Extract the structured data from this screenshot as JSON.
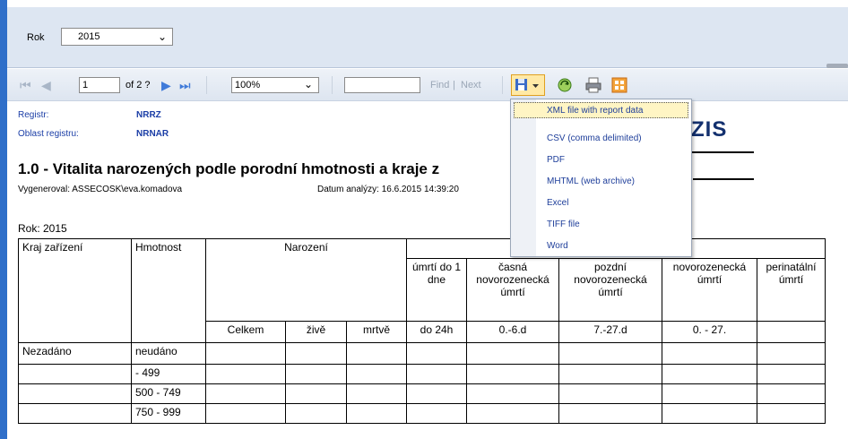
{
  "params": {
    "year_label": "Rok",
    "year_value": "2015"
  },
  "toolbar": {
    "first_icon": "⏮",
    "prev_icon": "◀",
    "page_value": "1",
    "page_of": "of 2 ?",
    "next_icon": "▶",
    "last_icon": "⏭",
    "zoom_value": "100%",
    "find_value": "",
    "find_label": "Find",
    "separator": "|",
    "next_label": "Next"
  },
  "export_menu": {
    "items": [
      "XML file with report data",
      "CSV (comma delimited)",
      "PDF",
      "MHTML (web archive)",
      "Excel",
      "TIFF file",
      "Word"
    ],
    "selected_index": 0
  },
  "report": {
    "registry_label": "Registr:",
    "registry_value": "NRRZ",
    "area_label": "Oblast registru:",
    "area_value": "NRNAR",
    "brand": "ZIS",
    "title": "1.0 - Vitalita narozených podle porodní hmotnosti a kraje z",
    "generated": "Vygeneroval: ASSECOSK\\eva.komadova",
    "analysis_date": "Datum analýzy: 16.6.2015 14:39:20",
    "year_line": "Rok: 2015",
    "table": {
      "col_region": "Kraj zařízení",
      "col_weight": "Hmotnost",
      "col_births": "Narození",
      "death_headers": [
        "úmrtí do 1 dne",
        "časná novorozenecká úmrtí",
        "pozdní novorozenecká úmrtí",
        "novorozenecká úmrtí",
        "perinatální úmrtí"
      ],
      "sub_headers": [
        "Celkem",
        "živě",
        "mrtvě",
        "do 24h",
        "0.-6.d",
        "7.-27.d",
        "0. - 27.",
        ""
      ],
      "rows": [
        {
          "region": "Nezadáno",
          "weight": "neudáno"
        },
        {
          "region": "",
          "weight": "- 499"
        },
        {
          "region": "",
          "weight": "500 - 749"
        },
        {
          "region": "",
          "weight": "750 - 999"
        }
      ]
    }
  }
}
